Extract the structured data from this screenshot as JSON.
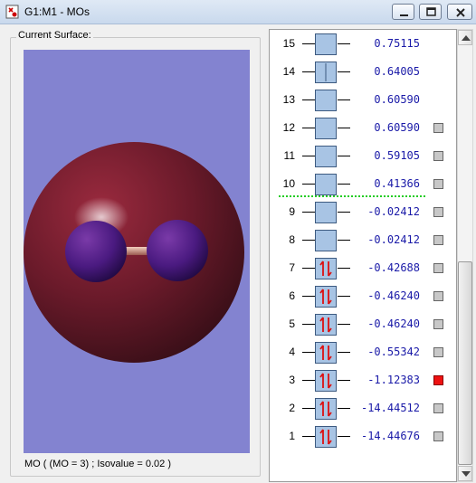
{
  "window": {
    "title": "G1:M1 - MOs",
    "icon": "gaussview-app-icon",
    "controls": [
      "minimize-icon",
      "maximize-icon",
      "close-icon"
    ]
  },
  "surface_panel": {
    "group_label": "Current Surface:",
    "caption": "MO ( (MO = 3) ; Isovalue = 0.02 )",
    "background_color": "#8383d0"
  },
  "orbitals": [
    {
      "number": "15",
      "energy": "0.75115",
      "occupied": false,
      "has_checkbox": false,
      "checked": false
    },
    {
      "number": "14",
      "energy": "0.64005",
      "occupied": false,
      "has_checkbox": false,
      "checked": false
    },
    {
      "number": "13",
      "energy": "0.60590",
      "occupied": false,
      "has_checkbox": false,
      "checked": false
    },
    {
      "number": "12",
      "energy": "0.60590",
      "occupied": false,
      "has_checkbox": true,
      "checked": false
    },
    {
      "number": "11",
      "energy": "0.59105",
      "occupied": false,
      "has_checkbox": true,
      "checked": false
    },
    {
      "number": "10",
      "energy": "0.41366",
      "occupied": false,
      "has_checkbox": true,
      "checked": false
    },
    {
      "number": "9",
      "energy": "-0.02412",
      "occupied": false,
      "has_checkbox": true,
      "checked": false
    },
    {
      "number": "8",
      "energy": "-0.02412",
      "occupied": false,
      "has_checkbox": true,
      "checked": false
    },
    {
      "number": "7",
      "energy": "-0.42688",
      "occupied": true,
      "has_checkbox": true,
      "checked": false
    },
    {
      "number": "6",
      "energy": "-0.46240",
      "occupied": true,
      "has_checkbox": true,
      "checked": false
    },
    {
      "number": "5",
      "energy": "-0.46240",
      "occupied": true,
      "has_checkbox": true,
      "checked": false
    },
    {
      "number": "4",
      "energy": "-0.55342",
      "occupied": true,
      "has_checkbox": true,
      "checked": false
    },
    {
      "number": "3",
      "energy": "-1.12383",
      "occupied": true,
      "has_checkbox": true,
      "checked": true
    },
    {
      "number": "2",
      "energy": "-14.44512",
      "occupied": true,
      "has_checkbox": true,
      "checked": false
    },
    {
      "number": "1",
      "energy": "-14.44676",
      "occupied": true,
      "has_checkbox": true,
      "checked": false
    }
  ],
  "colors": {
    "energy_text": "#1a1aa8",
    "box_fill": "#a8c4e4",
    "electron_arrow": "#dd1111",
    "homo_lumo_separator": "#22cc22",
    "selected_checkbox": "#ee1111"
  }
}
